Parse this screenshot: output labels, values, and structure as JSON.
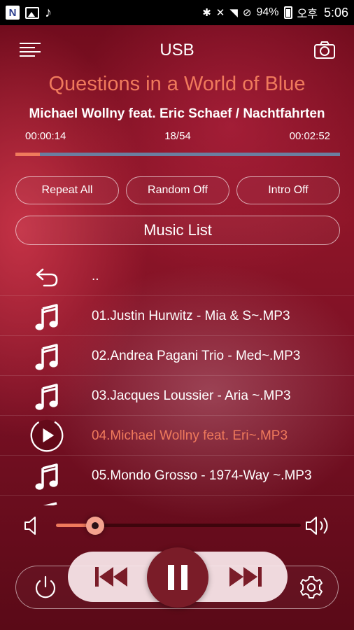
{
  "status_bar": {
    "notification_n": "N",
    "battery": "94%",
    "network": "오후",
    "time": "5:06"
  },
  "header": {
    "title": "USB",
    "menu_icon": "menu-icon",
    "camera_icon": "camera-icon"
  },
  "now_playing": {
    "title": "Questions in a World of Blue",
    "artist_album": "Michael Wollny feat. Eric Schaef / Nachtfahrten",
    "elapsed": "00:00:14",
    "track_position": "18/54",
    "total": "00:02:52",
    "progress_fraction": 0.075
  },
  "modes": {
    "repeat": "Repeat All",
    "random": "Random Off",
    "intro": "Intro Off"
  },
  "music_list_label": "Music List",
  "list": [
    {
      "icon": "back-arrow-icon",
      "label": "..",
      "active": false
    },
    {
      "icon": "music-note-icon",
      "label": "01.Justin Hurwitz - Mia & S~.MP3",
      "active": false
    },
    {
      "icon": "music-note-icon",
      "label": "02.Andrea Pagani Trio - Med~.MP3",
      "active": false
    },
    {
      "icon": "music-note-icon",
      "label": "03.Jacques Loussier - Aria ~.MP3",
      "active": false
    },
    {
      "icon": "play-circle-icon",
      "label": "04.Michael Wollny feat. Eri~.MP3",
      "active": true
    },
    {
      "icon": "music-note-icon",
      "label": "05.Mondo Grosso - 1974-Way ~.MP3",
      "active": false
    }
  ],
  "volume": {
    "level_fraction": 0.16
  },
  "controls": {
    "power": "power-icon",
    "previous": "skip-previous-icon",
    "pause": "pause-icon",
    "next": "skip-next-icon",
    "settings": "gear-icon"
  },
  "colors": {
    "accent": "#f07a5c",
    "background": "#8e1528",
    "progress_track": "#6b7ea0"
  }
}
